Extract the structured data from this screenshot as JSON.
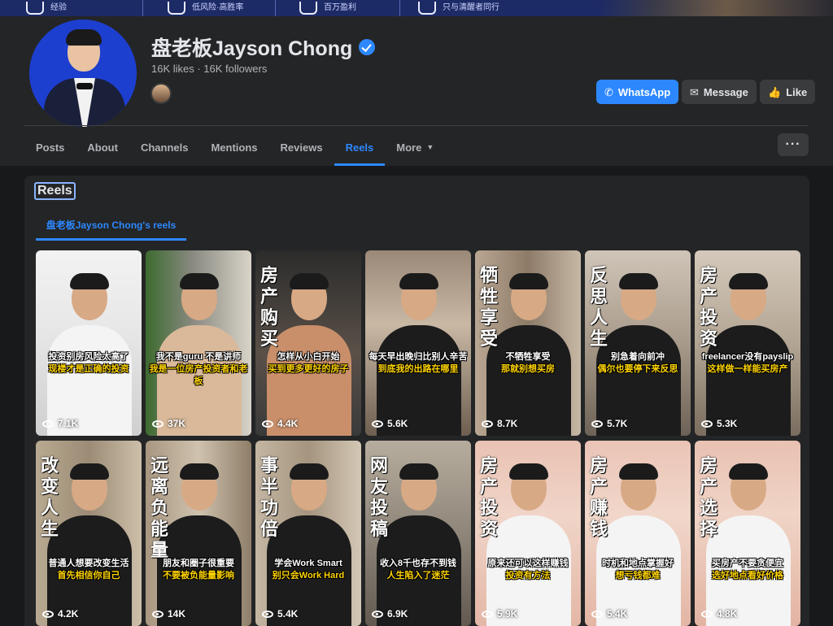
{
  "cover": {
    "items": [
      {
        "icon": "shield-icon",
        "text": "经验"
      },
      {
        "icon": "building-icon",
        "text": "低风险·高胜率"
      },
      {
        "icon": "bar-chart-icon",
        "text": "百万盈利"
      },
      {
        "icon": "group-icon",
        "text": "只与清醒者同行"
      }
    ]
  },
  "profile": {
    "name": "盘老板Jayson Chong",
    "stats": "16K likes · 16K followers"
  },
  "actions": {
    "whatsapp": "WhatsApp",
    "message": "Message",
    "like": "Like"
  },
  "tabs": [
    "Posts",
    "About",
    "Channels",
    "Mentions",
    "Reviews",
    "Reels",
    "More"
  ],
  "active_tab": "Reels",
  "more_menu": "···",
  "reels_section": {
    "title": "Reels",
    "subtab": "盘老板Jayson Chong's reels",
    "items": [
      {
        "vtext": "",
        "cap1": "投资别房风险太高了",
        "cap2": "现楼才是正确的投资",
        "views": "7.1K"
      },
      {
        "vtext": "",
        "cap1": "我不是guru 不是讲师",
        "cap2": "我是一位房产投资者和老板",
        "views": "37K"
      },
      {
        "vtext": "房产购买",
        "cap1": "怎样从小白开始",
        "cap2": "买到更多更好的房子",
        "views": "4.4K"
      },
      {
        "vtext": "",
        "cap1": "每天早出晚归比别人辛苦",
        "cap2": "到底我的出路在哪里",
        "views": "5.6K"
      },
      {
        "vtext": "牺牲享受",
        "cap1": "不牺牲享受",
        "cap2": "那就别想买房",
        "views": "8.7K"
      },
      {
        "vtext": "反思人生",
        "cap1": "别急着向前冲",
        "cap2": "偶尔也要停下来反思",
        "views": "5.7K"
      },
      {
        "vtext": "房产投资",
        "cap1": "freelancer没有payslip",
        "cap2": "这样做一样能买房产",
        "views": "5.3K"
      },
      {
        "vtext": "改变人生",
        "cap1": "普通人想要改变生活",
        "cap2": "首先相信你自己",
        "views": "4.2K"
      },
      {
        "vtext": "远离负能量",
        "cap1": "朋友和圈子很重要",
        "cap2": "不要被负能量影响",
        "views": "14K"
      },
      {
        "vtext": "事半功倍",
        "cap1": "学会Work Smart",
        "cap2": "别只会Work Hard",
        "views": "5.4K"
      },
      {
        "vtext": "网友投稿",
        "cap1": "收入8千也存不到钱",
        "cap2": "人生陷入了迷茫",
        "views": "6.9K"
      },
      {
        "vtext": "房产投资",
        "cap1": "原来还可以这样赚钱",
        "cap2": "投资有方法",
        "views": "5.9K"
      },
      {
        "vtext": "房产赚钱",
        "cap1": "时机和地点掌握好",
        "cap2": "想亏钱都难",
        "views": "5.4K"
      },
      {
        "vtext": "房产选择",
        "cap1": "买房产不要贪便宜",
        "cap2": "选好地点看好价格",
        "views": "4.8K"
      }
    ]
  }
}
